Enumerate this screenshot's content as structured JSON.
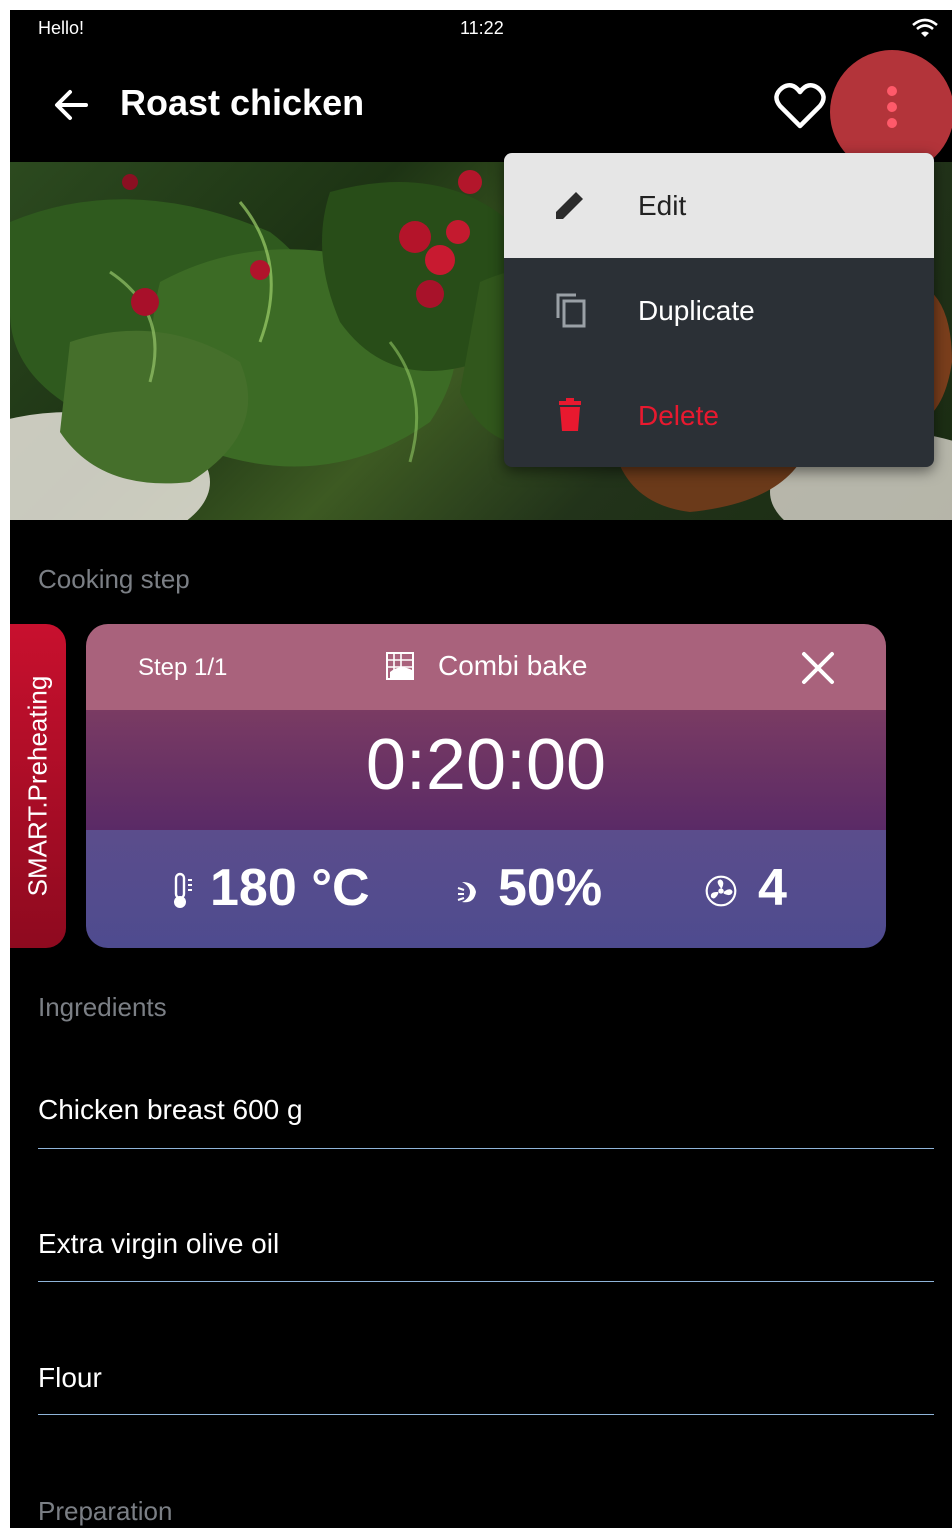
{
  "status_bar": {
    "greeting": "Hello!",
    "time": "11:22",
    "wifi_icon": "wifi-icon"
  },
  "header": {
    "title": "Roast chicken",
    "back_icon": "arrow-back-icon",
    "favorite_icon": "heart-outline-icon",
    "more_icon": "more-vertical-icon"
  },
  "menu": {
    "items": [
      {
        "label": "Edit",
        "icon": "pencil-icon"
      },
      {
        "label": "Duplicate",
        "icon": "copy-icon"
      },
      {
        "label": "Delete",
        "icon": "trash-icon",
        "color": "#e8192f"
      }
    ]
  },
  "cooking_step": {
    "section_label": "Cooking step",
    "smart_tab": "SMART.Preheating",
    "step": "Step 1/1",
    "mode": "Combi bake",
    "timer": "0:20:00",
    "temperature": "180 °C",
    "humidity": "50%",
    "fan": "4"
  },
  "ingredients": {
    "section_label": "Ingredients",
    "items": [
      "Chicken breast 600 g",
      "Extra virgin olive oil",
      "Flour"
    ]
  },
  "preparation": {
    "section_label": "Preparation"
  },
  "colors": {
    "accent_red": "#c8102e",
    "delete_red": "#e8192f",
    "card_top": "#a9627c",
    "card_bottom": "#4e4b8f"
  }
}
